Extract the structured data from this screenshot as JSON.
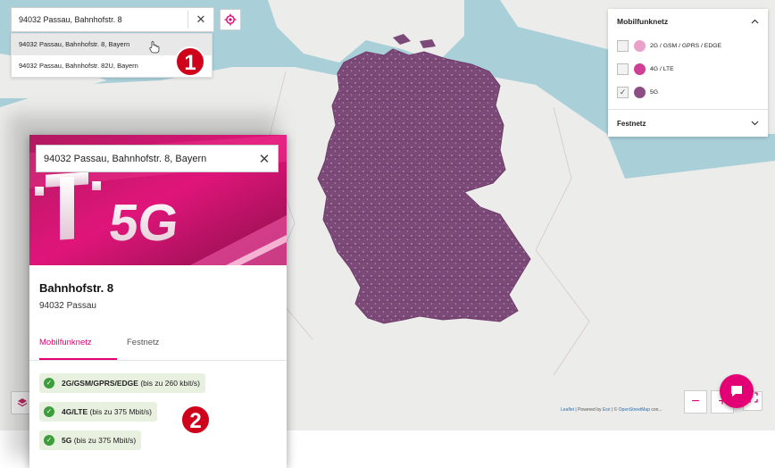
{
  "search_top": {
    "value": "94032 Passau, Bahnhofstr. 8",
    "clear_glyph": "✕"
  },
  "suggestions": [
    "94032 Passau, Bahnhofstr. 8, Bayern",
    "94032 Passau, Bahnhofstr. 82U, Bayern"
  ],
  "badges": {
    "one": "1",
    "two": "2"
  },
  "legend": {
    "section_title": "Mobilfunknetz",
    "items": [
      {
        "label": "2G / GSM / GPRS / EDGE",
        "color": "#e9a0c9",
        "checked": false
      },
      {
        "label": "4G / LTE",
        "color": "#cf3f96",
        "checked": false
      },
      {
        "label": "5G",
        "color": "#8d4f83",
        "checked": true
      }
    ],
    "footer_title": "Festnetz"
  },
  "attribution": {
    "leaflet": "Leaflet",
    "powered": " | Powered by ",
    "esri": "Esri",
    "sep": " | © ",
    "osm": "OpenStreetMap",
    "contrib": " con..."
  },
  "zoom": {
    "minus": "−",
    "plus": "+"
  },
  "card": {
    "search_value": "94032 Passau, Bahnhofstr. 8, Bayern",
    "hero_text": "T 5G",
    "street": "Bahnhofstr. 8",
    "city": "94032 Passau",
    "tabs": [
      "Mobilfunknetz",
      "Festnetz"
    ],
    "active_tab": 0,
    "coverage": [
      {
        "tech": "2G/GSM/GPRS/EDGE",
        "speed": "(bis zu 260 kbit/s)"
      },
      {
        "tech": "4G/LTE",
        "speed": "(bis zu 375 Mbit/s)"
      },
      {
        "tech": "5G",
        "speed": "(bis zu 375 Mbit/s)"
      }
    ]
  },
  "colors": {
    "magenta": "#e20074",
    "coverage": "#7f4d7a",
    "water": "#a9cfd8",
    "land": "#ececea",
    "badge": "#d0021b"
  }
}
